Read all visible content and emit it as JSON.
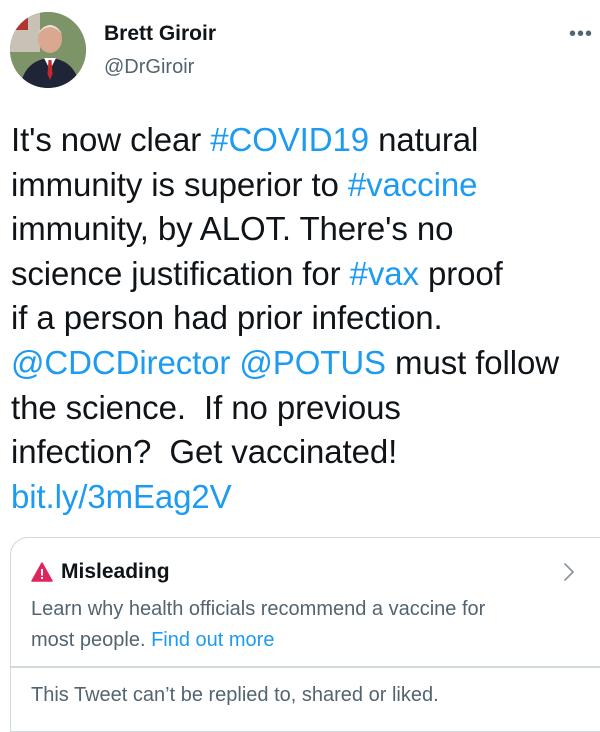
{
  "author": {
    "name": "Brett Giroir",
    "handle": "@DrGiroir"
  },
  "more_button": "•••",
  "tweet": {
    "lines": [
      [
        {
          "t": "It's now clear "
        },
        {
          "t": "#COVID19",
          "link": true
        },
        {
          "t": " natural"
        }
      ],
      [
        {
          "t": "immunity is superior to "
        },
        {
          "t": "#vaccine",
          "link": true
        }
      ],
      [
        {
          "t": "immunity, by ALOT. There's no"
        }
      ],
      [
        {
          "t": "science justification for "
        },
        {
          "t": "#vax",
          "link": true
        },
        {
          "t": " proof"
        }
      ],
      [
        {
          "t": "if a person had prior infection."
        }
      ],
      [
        {
          "t": "@CDCDirector",
          "link": true
        },
        {
          "t": " "
        },
        {
          "t": "@POTUS",
          "link": true
        },
        {
          "t": " must follow"
        }
      ],
      [
        {
          "t": "the science.  If no previous"
        }
      ],
      [
        {
          "t": "infection?  Get vaccinated!"
        }
      ],
      [
        {
          "t": "bit.ly/3mEag2V",
          "link": true
        }
      ]
    ]
  },
  "label_card": {
    "title": "Misleading",
    "body_line1": "Learn why health officials recommend a vaccine for",
    "body_line2": "most people. ",
    "link": "Find out more",
    "restriction": "This Tweet can’t be replied to, shared or liked."
  },
  "colors": {
    "link": "#1d9bf0",
    "warning": "#e0245e",
    "secondary_text": "#536471"
  },
  "icons": {
    "warning": "warning-triangle-icon",
    "chevron": "chevron-right-icon",
    "avatar": "profile-photo"
  }
}
